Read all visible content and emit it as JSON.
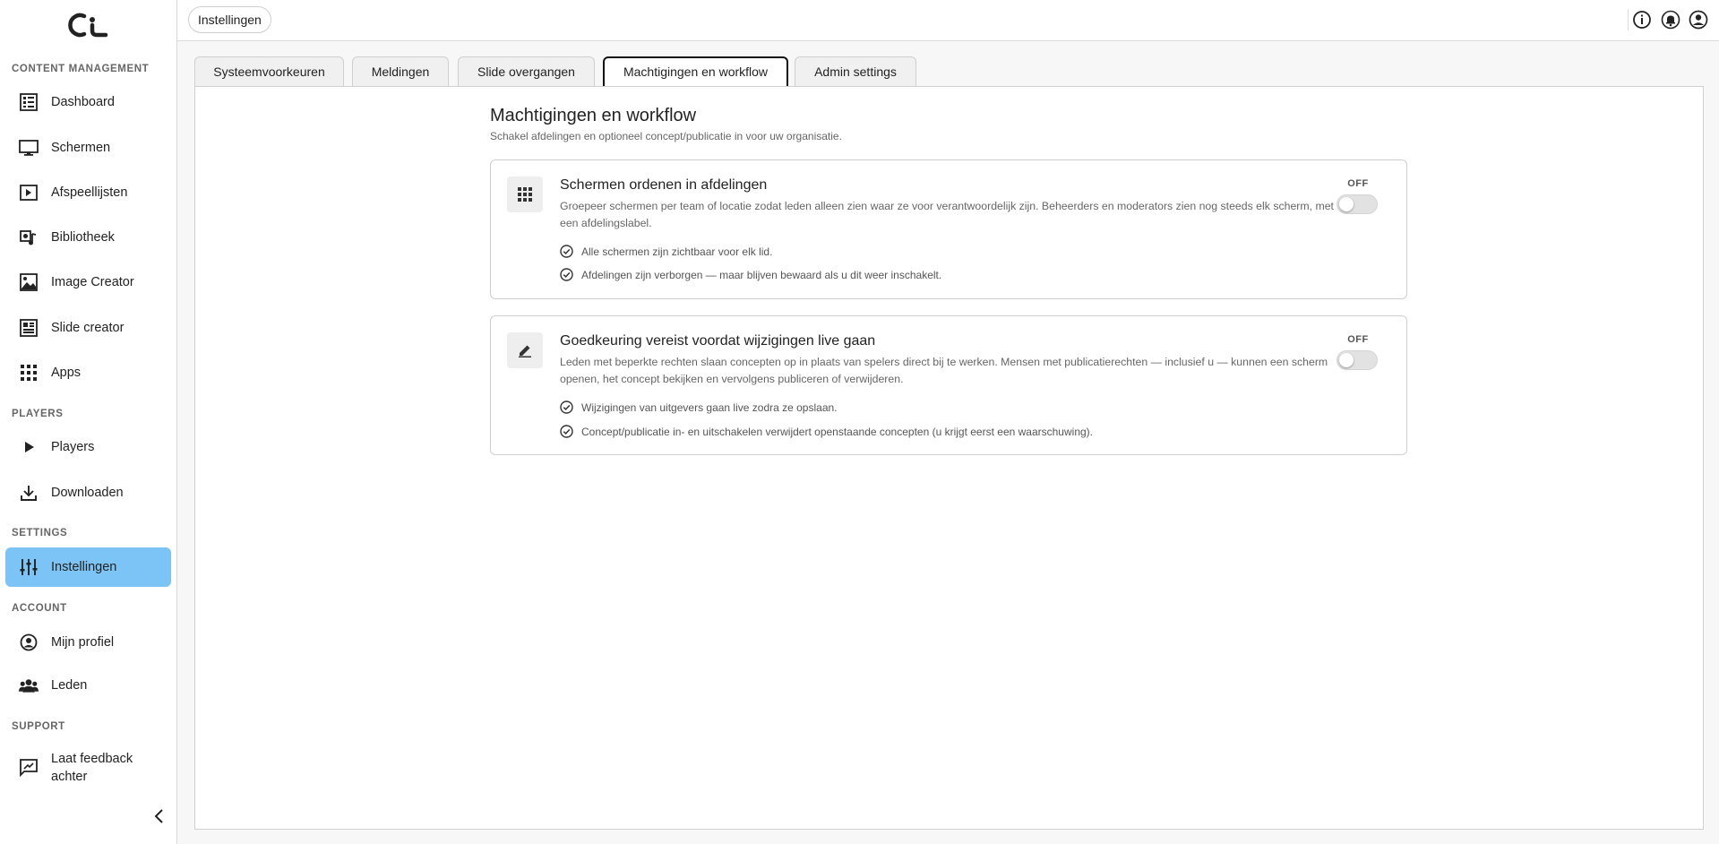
{
  "breadcrumb": "Instellingen",
  "sidebar": {
    "sections": {
      "content": "CONTENT MANAGEMENT",
      "players": "PLAYERS",
      "settings": "SETTINGS",
      "account": "ACCOUNT",
      "support": "SUPPORT"
    },
    "items": {
      "dashboard": "Dashboard",
      "schermen": "Schermen",
      "afspeellijsten": "Afspeellijsten",
      "bibliotheek": "Bibliotheek",
      "image_creator": "Image Creator",
      "slide_creator": "Slide creator",
      "apps": "Apps",
      "players": "Players",
      "downloaden": "Downloaden",
      "instellingen": "Instellingen",
      "mijn_profiel": "Mijn profiel",
      "leden": "Leden",
      "feedback_line1": "Laat feedback",
      "feedback_line2": "achter"
    },
    "active_color": "#7cc4f5"
  },
  "tabs": {
    "systeemvoorkeuren": "Systeemvoorkeuren",
    "meldingen": "Meldingen",
    "slide_overgangen": "Slide overgangen",
    "machtigingen": "Machtigingen en workflow",
    "admin": "Admin settings",
    "active": "Machtigingen en workflow"
  },
  "main": {
    "title": "Machtigingen en workflow",
    "subtitle": "Schakel afdelingen en optioneel concept/publicatie in voor uw organisatie.",
    "cards": [
      {
        "icon": "grid-icon",
        "title": "Schermen ordenen in afdelingen",
        "description": "Groepeer schermen per team of locatie zodat leden alleen zien waar ze voor verantwoordelijk zijn. Beheerders en moderators zien nog steeds elk scherm, met een afdelingslabel.",
        "checks": [
          "Alle schermen zijn zichtbaar voor elk lid.",
          "Afdelingen zijn verborgen — maar blijven bewaard als u dit weer inschakelt."
        ],
        "toggle_label": "OFF"
      },
      {
        "icon": "pencil-icon",
        "title": "Goedkeuring vereist voordat wijzigingen live gaan",
        "description": "Leden met beperkte rechten slaan concepten op in plaats van spelers direct bij te werken. Mensen met publicatierechten — inclusief u — kunnen een scherm openen, het concept bekijken en vervolgens publiceren of verwijderen.",
        "checks": [
          "Wijzigingen van uitgevers gaan live zodra ze opslaan.",
          "Concept/publicatie in- en uitschakelen verwijdert openstaande concepten (u krijgt eerst een waarschuwing)."
        ],
        "toggle_label": "OFF"
      }
    ]
  }
}
